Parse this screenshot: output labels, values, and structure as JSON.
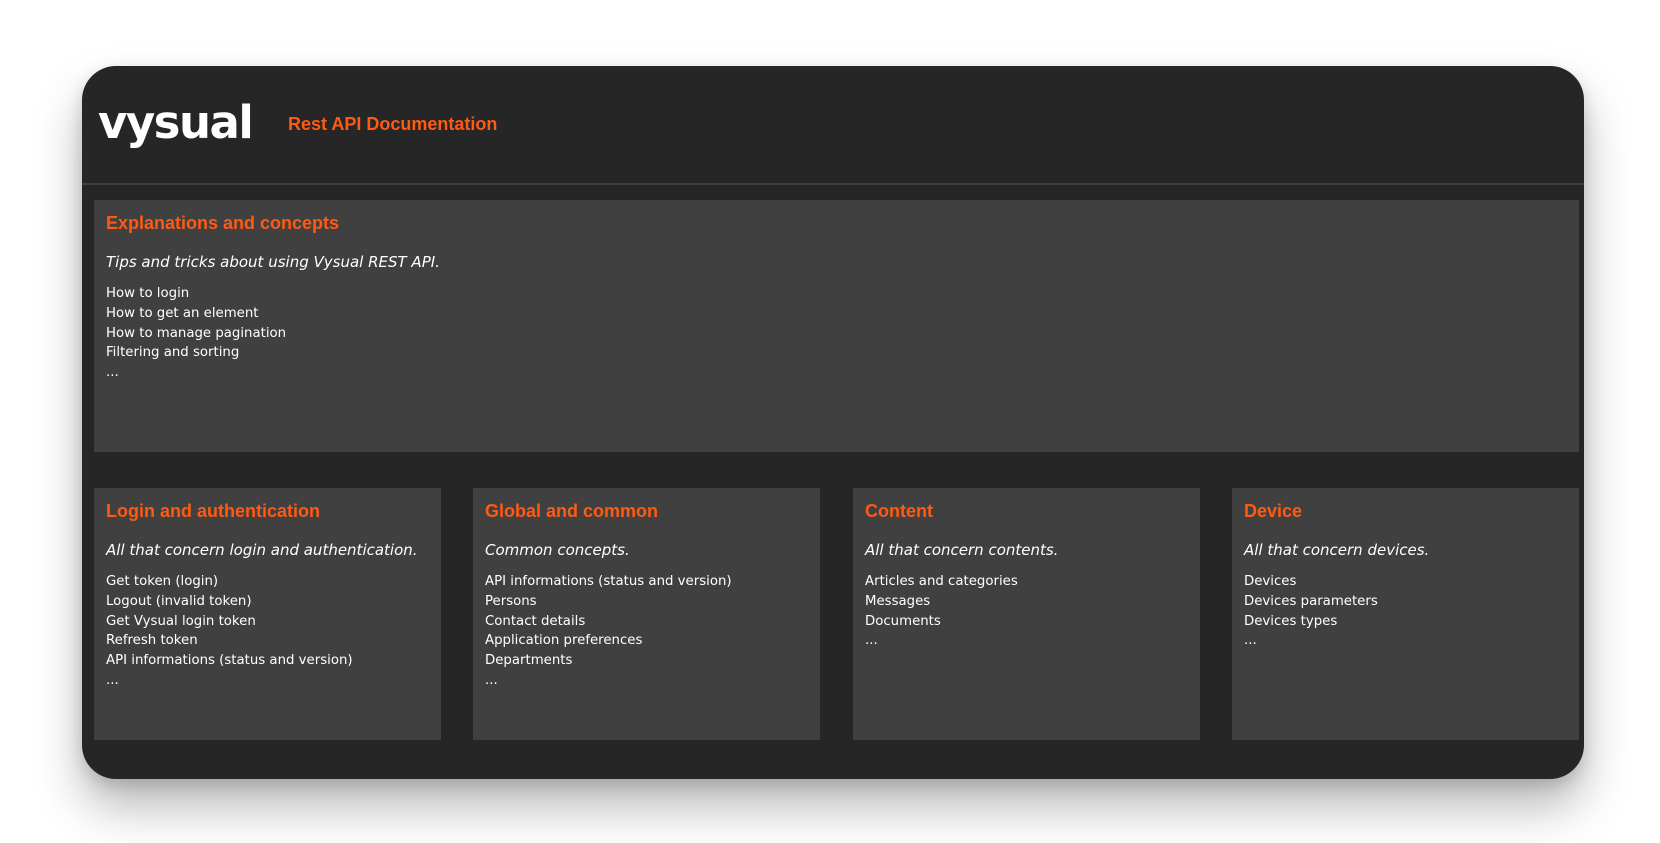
{
  "header": {
    "logo_text": "vysual",
    "title": "Rest API Documentation"
  },
  "colors": {
    "accent": "#ff5a12",
    "window_bg": "#262626",
    "card_bg": "#404040",
    "text": "#ffffff"
  },
  "sections": {
    "explanations": {
      "title": "Explanations and concepts",
      "description": "Tips and tricks about using Vysual REST API.",
      "items": [
        "How to login",
        "How to get an element",
        "How to manage pagination",
        "Filtering and sorting",
        "..."
      ]
    },
    "login": {
      "title": "Login and authentication",
      "description": "All that concern login and authentication.",
      "items": [
        "Get token (login)",
        "Logout (invalid token)",
        "Get Vysual login token",
        "Refresh token",
        "API informations (status and version)",
        "..."
      ]
    },
    "global": {
      "title": "Global and common",
      "description": "Common concepts.",
      "items": [
        "API informations (status and version)",
        "Persons",
        "Contact details",
        "Application preferences",
        "Departments",
        "..."
      ]
    },
    "content": {
      "title": "Content",
      "description": "All that concern contents.",
      "items": [
        "Articles and categories",
        "Messages",
        "Documents",
        "..."
      ]
    },
    "device": {
      "title": "Device",
      "description": "All that concern devices.",
      "items": [
        "Devices",
        "Devices parameters",
        "Devices types",
        "..."
      ]
    }
  }
}
